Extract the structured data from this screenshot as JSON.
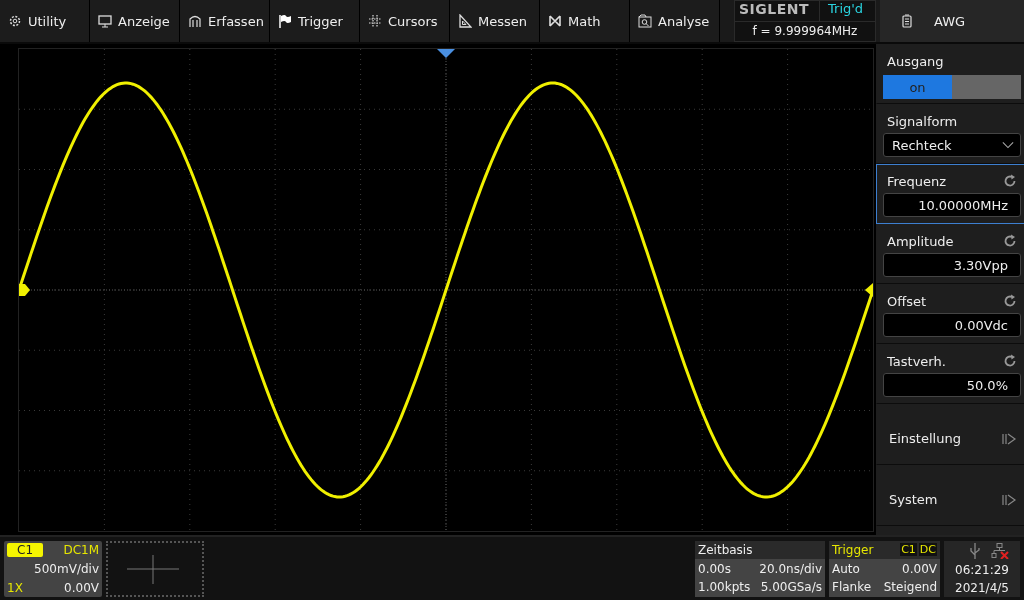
{
  "menu": [
    {
      "label": "Utility"
    },
    {
      "label": "Anzeige"
    },
    {
      "label": "Erfassen"
    },
    {
      "label": "Trigger"
    },
    {
      "label": "Cursors"
    },
    {
      "label": "Messen"
    },
    {
      "label": "Math"
    },
    {
      "label": "Analyse"
    }
  ],
  "brand": {
    "logo": "SIGLENT",
    "trigger_status": "Trig'd",
    "frequency": "f = 9.999964MHz"
  },
  "panel": {
    "title": "AWG",
    "items": [
      {
        "kind": "toggle",
        "label": "Ausgang",
        "value": "on",
        "on": true,
        "selected": false
      },
      {
        "kind": "dropdown",
        "label": "Signalform",
        "value": "Rechteck",
        "selected": false
      },
      {
        "kind": "field",
        "label": "Frequenz",
        "value": "10.00000MHz",
        "selected": true
      },
      {
        "kind": "field",
        "label": "Amplitude",
        "value": "3.30Vpp",
        "selected": false
      },
      {
        "kind": "field",
        "label": "Offset",
        "value": "0.00Vdc",
        "selected": false
      },
      {
        "kind": "field",
        "label": "Tastverh.",
        "value": "50.0%",
        "selected": false
      },
      {
        "kind": "submenu",
        "label": "Einstellung",
        "selected": false
      },
      {
        "kind": "submenu",
        "label": "System",
        "selected": false
      }
    ]
  },
  "channel": {
    "name": "C1",
    "coupling": "DC1M",
    "scale": "500mV/div",
    "probe": "1X",
    "offset": "0.00V"
  },
  "timebase": {
    "title": "Zeitbasis",
    "delay": "0.00s",
    "scale": "20.0ns/div",
    "memory": "1.00kpts",
    "sample_rate": "5.00GSa/s"
  },
  "trigger": {
    "title": "Trigger",
    "source": "C1",
    "coupling": "DC",
    "mode": "Auto",
    "level": "0.00V",
    "type": "Flanke",
    "slope": "Steigend"
  },
  "status": {
    "time": "06:21:29",
    "date": "2021/4/5"
  }
}
